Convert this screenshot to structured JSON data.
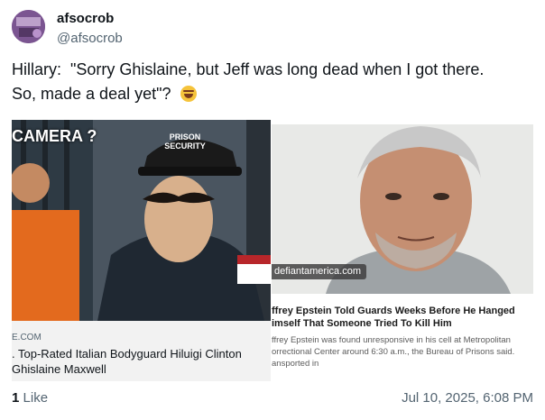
{
  "author": {
    "display_name": "afsocrob",
    "handle": "@afsocrob"
  },
  "post": {
    "text_line1": "Hillary:  \"Sorry Ghislaine, but Jeff was long dead when I got there.",
    "text_line2": "So, made a deal yet\"?",
    "emoji": "rolling-on-floor-laughing"
  },
  "card_left": {
    "image_caption_banner": "CAMERA ?",
    "cap_text": "PRISON SECURITY",
    "domain": "E.COM",
    "title_line1": ". Top-Rated Italian Bodyguard Hiluigi Clinton",
    "title_line2": "Ghislaine Maxwell"
  },
  "card_right": {
    "domain": "defiantamerica.com",
    "title_line1": "ffrey Epstein Told Guards Weeks Before He Hanged",
    "title_line2": "imself That Someone Tried To Kill Him",
    "desc_line1": "ffrey Epstein was found unresponsive in his cell at Metropolitan",
    "desc_line2": "orrectional Center around 6:30 a.m., the Bureau of Prisons said.",
    "desc_line3": "ansported in"
  },
  "footer": {
    "likes_count": "1",
    "likes_label": "Like",
    "date": "Jul 10, 2025, 6:08 PM"
  },
  "colors": {
    "text_primary": "#0f1419",
    "text_secondary": "#536471",
    "card_background": "#f2f2f2"
  }
}
